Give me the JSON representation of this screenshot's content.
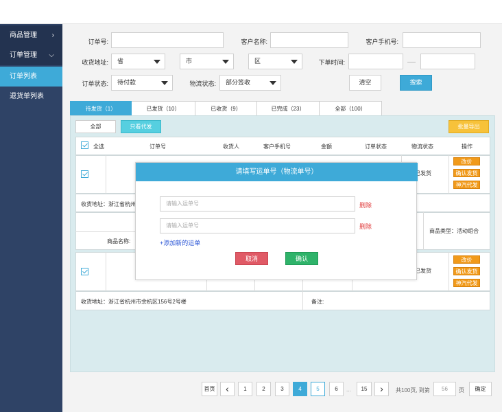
{
  "sidebar": {
    "items": [
      {
        "label": "商品管理",
        "chevron": "›"
      },
      {
        "label": "订单管理",
        "chevron": "⌵"
      },
      {
        "label": "订单列表"
      },
      {
        "label": "退货单列表"
      }
    ]
  },
  "filters": {
    "order_no_label": "订单号:",
    "customer_name_label": "客户名称:",
    "customer_phone_label": "客户手机号:",
    "address_label": "收货地址:",
    "province_value": "省",
    "city_value": "市",
    "district_value": "区",
    "order_time_label": "下单时间:",
    "order_status_label": "订单状态:",
    "order_status_value": "待付款",
    "logistics_status_label": "物流状态:",
    "logistics_status_value": "部分签收",
    "clear_label": "清空",
    "search_label": "搜索"
  },
  "tabs": [
    {
      "label": "待发货（1）"
    },
    {
      "label": "已发货（10）"
    },
    {
      "label": "已收货（9）"
    },
    {
      "label": "已完成（23）"
    },
    {
      "label": "全部（100）"
    }
  ],
  "toolbar": {
    "all_label": "全部",
    "proxy_only_label": "只看代发",
    "batch_export_label": "批量导出"
  },
  "table": {
    "headers": {
      "select_all": "全选",
      "order_no": "订单号",
      "receiver": "收货人",
      "phone": "客户手机号",
      "amount": "金额",
      "order_status": "订单状态",
      "logistics_status": "物流状态",
      "actions": "操作"
    },
    "row1": {
      "logistics_status": "已发货",
      "actions": [
        "改价",
        "确认发货",
        "神汽代发"
      ],
      "address": "收货地址：浙江省杭州",
      "product_name_label": "商品名称:",
      "product_type": "商品类型：活动组合"
    },
    "row2": {
      "logistics_status": "已发货",
      "actions": [
        "改价",
        "确认发货",
        "神汽代发"
      ],
      "address": "收货地址：浙江省杭州市余杭区156号2号楼",
      "remark_label": "备注:"
    }
  },
  "pagination": {
    "first": "首页",
    "prev": "‹",
    "pages": [
      "1",
      "2",
      "3",
      "4",
      "5",
      "6"
    ],
    "ellipsis": "...",
    "last_page": "15",
    "next": "›",
    "total_text": "共100页, 到第",
    "page_input": "56",
    "page_unit": "页",
    "confirm": "确定"
  },
  "modal": {
    "title": "请填写运单号（物流单号）",
    "input_placeholder": "请输入运单号",
    "delete_label": "删除",
    "add_label": "+添加新的运单",
    "cancel_label": "取消",
    "confirm_label": "确认"
  },
  "colors": {
    "sidebar": "#2f4366",
    "accent": "#3eaad8",
    "orange": "#f19a1a",
    "cancel": "#e05a66",
    "confirm": "#2fb36a"
  }
}
